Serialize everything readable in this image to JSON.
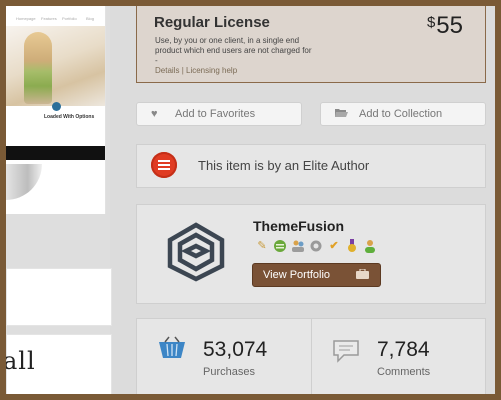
{
  "preview": {
    "nav": [
      "Homepage",
      "Features",
      "Portfolio",
      "Blog"
    ],
    "caption": "Loaded With Options",
    "large_text": "all"
  },
  "license": {
    "title": "Regular License",
    "currency": "$",
    "price": "55",
    "description": "Use, by you or one client, in a single end product which end users are not charged for -",
    "details_link": "Details",
    "separator": "|",
    "licensing_link": "Licensing help"
  },
  "actions": {
    "favorites_label": "Add to Favorites",
    "collection_label": "Add to Collection",
    "favorites_icon": "heart-icon",
    "collection_icon": "folder-icon"
  },
  "elite": {
    "text": "This item is by an Elite Author",
    "badge_color": "#e03b22"
  },
  "author": {
    "name": "ThemeFusion",
    "portfolio_label": "View Portfolio",
    "portfolio_color": "#7a5236",
    "badges": [
      "pencil-icon",
      "green-badge-icon",
      "users-icon",
      "gear-icon",
      "checkmark-icon",
      "medal-icon",
      "user-star-icon"
    ]
  },
  "stats": {
    "purchases_count": "53,074",
    "purchases_label": "Purchases",
    "comments_count": "7,784",
    "comments_label": "Comments",
    "purchases_icon": "basket-icon",
    "comments_icon": "speech-bubble-icon"
  }
}
